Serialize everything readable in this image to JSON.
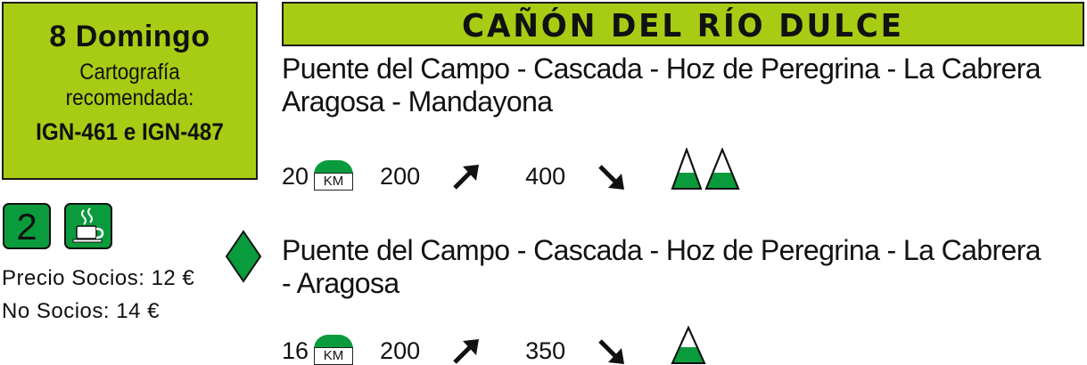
{
  "date_box": {
    "day": "8 Domingo",
    "cartography_label": "Cartografía recomendada:",
    "maps": "IGN-461 e IGN-487"
  },
  "title": "CAÑÓN DEL RÍO DULCE",
  "route_long": {
    "line1": "Puente del Campo - Cascada - Hoz de Peregrina - La Cabrera",
    "line2": "Aragosa - Mandayona",
    "distance": "20",
    "km_label": "KM",
    "ascent": "200",
    "descent": "400",
    "difficulty_peaks": 2
  },
  "route_short": {
    "line1": "Puente del Campo - Cascada - Hoz de Peregrina - La Cabrera",
    "line2": "-  Aragosa",
    "distance": "16",
    "km_label": "KM",
    "ascent": "200",
    "descent": "350",
    "difficulty_peaks": 1
  },
  "level_badge": "2",
  "icons": {
    "coffee": "coffee-cup-icon",
    "diamond": "diamond-marker-icon",
    "km": "km-marker-icon",
    "up": "arrow-up-right-icon",
    "down": "arrow-down-right-icon",
    "peak": "mountain-peak-icon"
  },
  "prices": {
    "members": "Precio Socios: 12 €",
    "non_members": "No Socios: 14 €"
  },
  "colors": {
    "lime": "#a8cc14",
    "green": "#0a9b3c"
  }
}
